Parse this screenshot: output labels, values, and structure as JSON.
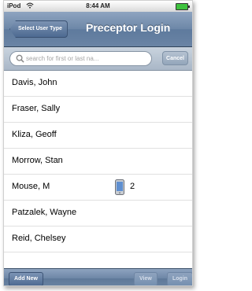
{
  "status_bar": {
    "carrier": "iPod",
    "time": "8:44 AM"
  },
  "nav": {
    "back_label": "Select User Type",
    "title": "Preceptor Login"
  },
  "search": {
    "placeholder": "search for first or last na...",
    "cancel_label": "Cancel"
  },
  "list": {
    "items": [
      {
        "name": "Davis, John"
      },
      {
        "name": "Fraser, Sally"
      },
      {
        "name": "Kliza, Geoff"
      },
      {
        "name": "Morrow, Stan"
      },
      {
        "name": "Mouse, M",
        "device_icon": "ipod-device-icon",
        "count": "2"
      },
      {
        "name": "Patzalek, Wayne"
      },
      {
        "name": "Reid, Chelsey"
      }
    ]
  },
  "toolbar": {
    "add_label": "Add New",
    "view_label": "View",
    "login_label": "Login"
  },
  "colors": {
    "nav_blue": "#6d87a7",
    "battery_green": "#3ec23e"
  }
}
